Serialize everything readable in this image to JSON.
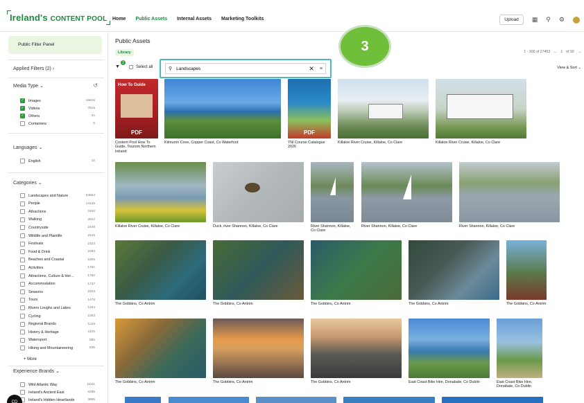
{
  "header": {
    "logo_main": "Ireland's ",
    "logo_sc": "Content Pool",
    "nav": [
      "Home",
      "Public Assets",
      "Internal Assets",
      "Marketing Toolkits"
    ],
    "upload_label": "Upload"
  },
  "sidebar": {
    "filter_panel": "Public Filter Panel",
    "applied_filters": "Applied Filters (2)",
    "media_type_heading": "Media Type",
    "media_type": [
      {
        "label": "Images",
        "count": "19816",
        "checked": true
      },
      {
        "label": "Videos",
        "count": "7616",
        "checked": true
      },
      {
        "label": "Others",
        "count": "21",
        "checked": true
      },
      {
        "label": "Containers",
        "count": "5",
        "checked": false
      }
    ],
    "languages_heading": "Languages",
    "languages": [
      {
        "label": "English",
        "count": "12"
      }
    ],
    "categories_heading": "Categories",
    "categories": [
      {
        "label": "Landscapes and Nature",
        "count": "34554"
      },
      {
        "label": "People",
        "count": "14146"
      },
      {
        "label": "Attractions",
        "count": "3342"
      },
      {
        "label": "Walking",
        "count": "2522"
      },
      {
        "label": "Countryside",
        "count": "2448"
      },
      {
        "label": "Wildlife and Plantlife",
        "count": "2415"
      },
      {
        "label": "Festivals",
        "count": "2323"
      },
      {
        "label": "Food & Drink",
        "count": "2293"
      },
      {
        "label": "Beaches and Coastal",
        "count": "1806"
      },
      {
        "label": "Activities",
        "count": "1781"
      },
      {
        "label": "Attractions, Culture & Her...",
        "count": "1760"
      },
      {
        "label": "Accommodation",
        "count": "1737"
      },
      {
        "label": "Seasons",
        "count": "1503"
      },
      {
        "label": "Tours",
        "count": "1478"
      },
      {
        "label": "Rivers Loughs and Lakes",
        "count": "1464"
      },
      {
        "label": "Cycling",
        "count": "1253"
      },
      {
        "label": "Regional Brands",
        "count": "1229"
      },
      {
        "label": "History & Heritage",
        "count": "1126"
      },
      {
        "label": "Watersport",
        "count": "895"
      },
      {
        "label": "Hiking and Mountaineering",
        "count": "835"
      }
    ],
    "more_label": "More",
    "experience_heading": "Experience Brands",
    "experience": [
      {
        "label": "Wild Atlantic Way",
        "count": "11111"
      },
      {
        "label": "Ireland's Ancient East",
        "count": "6295"
      },
      {
        "label": "Ireland's Hidden Heartlands",
        "count": "3865"
      }
    ],
    "chat_label": "CD"
  },
  "main": {
    "title": "Public Assets",
    "library": "Library",
    "pager_range": "1 - 300 of 27453",
    "pager_page": "1",
    "pager_of": "of 92",
    "filter_badge": "2",
    "select_all": "Select all",
    "search_value": "Landscapes",
    "step_number": "3",
    "view_sort": "View & Sort",
    "pdf_label": "PDF",
    "how_to_label": "How To Guide",
    "captions": {
      "c1": "Content Pool How To Guide, Tourism Northern Ireland",
      "c2": "Kilmurrin Cove, Copper Coast, Co Waterford",
      "c3": "TNI Course Catalogue 2026",
      "c4": "Killaloe River Cruise, Killaloe, Co Clare",
      "c5": "Killaloe River Cruise, Killaloe, Co Clare",
      "c6": "Killaloe River Cruise, Killaloe, Co Clare",
      "c7": "Duck, river Shannon, Killaloe, Co Clare",
      "c8": "River Shannon, Killaloe, Co Clare",
      "c9": "River Shannon, Killaloe, Co Clare",
      "c10": "River Shannon, Killaloe, Co Clare",
      "c11": "The Gobbins, Co Antrim",
      "c12": "The Gobbins, Co Antrim",
      "c13": "The Gobbins, Co Antrim",
      "c14": "The Gobbins, Co Antrim",
      "c15": "The Gobbins, Co Antrim",
      "c16": "The Gobbins, Co Antrim",
      "c17": "The Gobbins, Co Antrim",
      "c18": "The Gobbins, Co Antrim",
      "c19": "East Coast Bike Hire, Donabate, Co Dublin",
      "c20": "East Coast Bike Hire, Donabate, Co Dublin"
    }
  },
  "colors": {
    "brand_green": "#1a8a3a",
    "highlight_teal": "#4bb8c2",
    "badge_green": "#6fbf3a"
  }
}
